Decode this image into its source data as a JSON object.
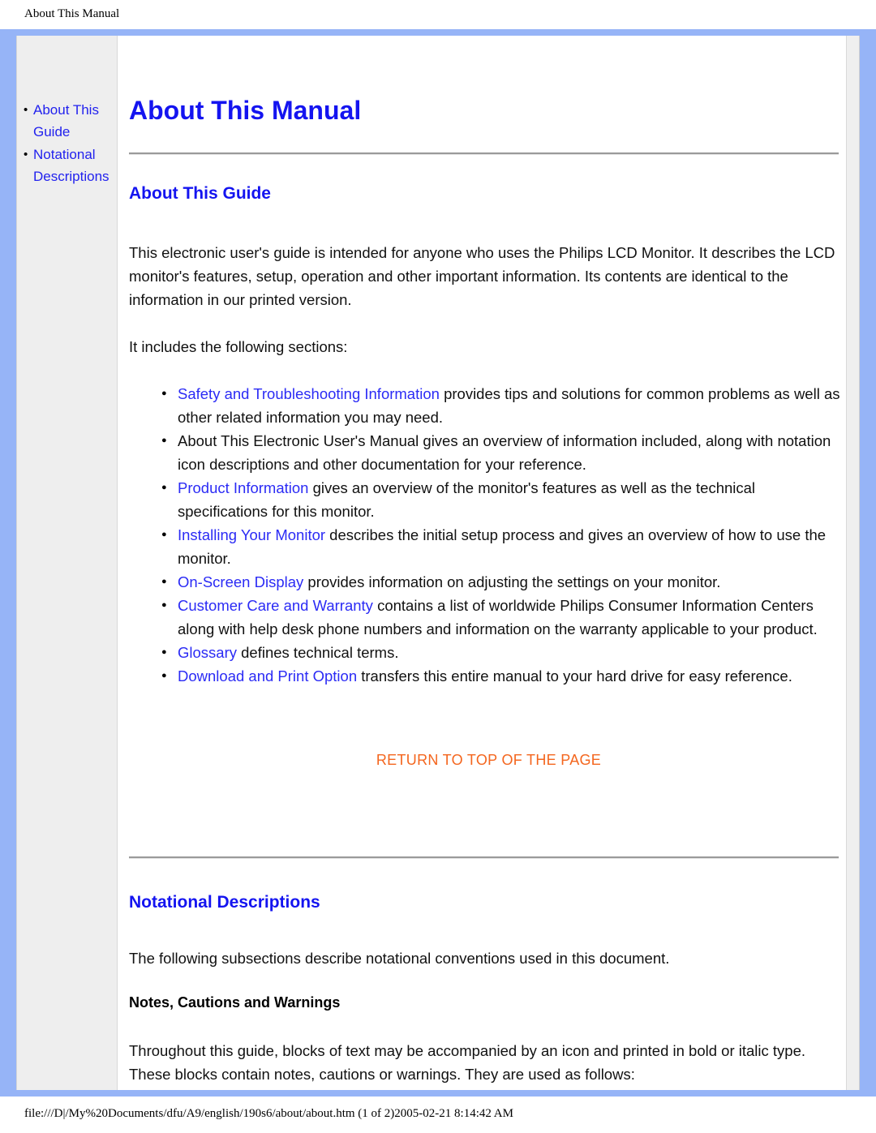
{
  "print_header": {
    "title": "About This Manual"
  },
  "print_footer": {
    "path": "file:///D|/My%20Documents/dfu/A9/english/190s6/about/about.htm (1 of 2)2005-02-21 8:14:42 AM"
  },
  "colors": {
    "frame_border": "#96b4f7",
    "sidebar_background": "#eeeeee",
    "heading_blue": "#1414f0",
    "link_blue": "#2b2bf5",
    "return_orange": "#f4661e"
  },
  "sidebar": {
    "items": [
      {
        "label": "About This Guide"
      },
      {
        "label": "Notational Descriptions"
      }
    ]
  },
  "main": {
    "title": "About This Manual",
    "section_about": {
      "heading": "About This Guide",
      "intro_paragraph": "This electronic user's guide is intended for anyone who uses the Philips LCD Monitor. It describes the LCD monitor's features, setup, operation and other important information. Its contents are identical to the information in our printed version.",
      "includes_line": "It includes the following sections:",
      "bullets": [
        {
          "link": "Safety and Troubleshooting Information",
          "text": " provides tips and solutions for common problems as well as other related information you may need."
        },
        {
          "link": "",
          "text": "About This Electronic User's Manual gives an overview of information included, along with notation icon descriptions and other documentation for your reference."
        },
        {
          "link": "Product Information",
          "text": " gives an overview of the monitor's features as well as the technical specifications for this monitor."
        },
        {
          "link": "Installing Your Monitor",
          "text": " describes the initial setup process and gives an overview of how to use the monitor."
        },
        {
          "link": "On-Screen Display",
          "text": " provides information on adjusting the settings on your monitor."
        },
        {
          "link": "Customer Care and Warranty",
          "text": " contains a list of worldwide Philips Consumer Information Centers along with help desk phone numbers and information on the warranty applicable to your product."
        },
        {
          "link": "Glossary",
          "text": " defines technical terms."
        },
        {
          "link": "Download and Print Option",
          "text": " transfers this entire manual to your hard drive for easy reference."
        }
      ],
      "return_to_top": "RETURN TO TOP OF THE PAGE"
    },
    "section_notational": {
      "heading": "Notational Descriptions",
      "intro_paragraph": "The following subsections describe notational conventions used in this document.",
      "subheading": "Notes, Cautions and Warnings",
      "body_paragraph": "Throughout this guide, blocks of text may be accompanied by an icon and printed in bold or italic type. These blocks contain notes, cautions or warnings. They are used as follows:"
    }
  }
}
